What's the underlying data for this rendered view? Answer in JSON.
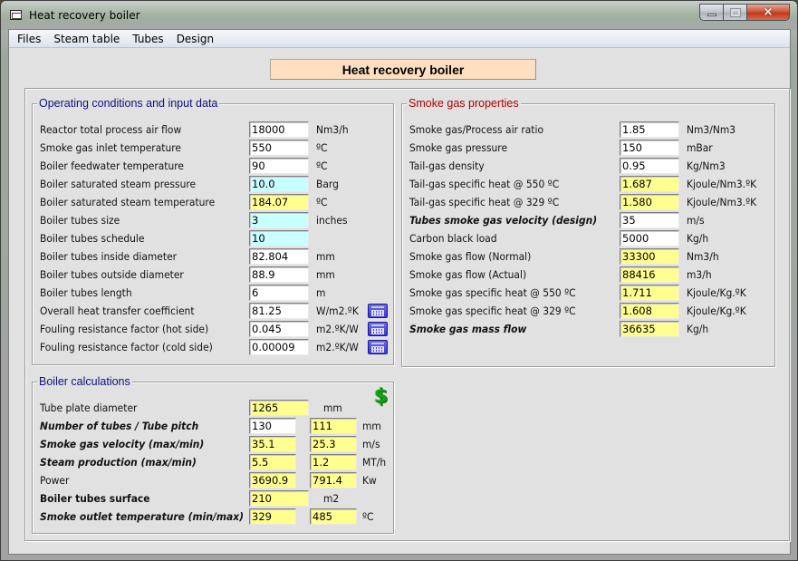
{
  "window": {
    "title": "Heat recovery boiler",
    "controls": {
      "minimize": "minimize",
      "maximize": "maximize",
      "close": "×"
    }
  },
  "menu": [
    "Files",
    "Steam table",
    "Tubes",
    "Design"
  ],
  "banner": "Heat recovery boiler",
  "colors": {
    "input_white": "#ffffff",
    "input_cyan": "#c8ffff",
    "computed_yellow": "#ffff90",
    "title_blue": "#101080",
    "title_red": "#b00000",
    "banner_bg": "#ffdfbf"
  },
  "operating": {
    "title": "Operating conditions and input data",
    "rows": [
      {
        "label": "Reactor total process air flow",
        "value": "18000",
        "unit": "Nm3/h"
      },
      {
        "label": "Smoke gas inlet temperature",
        "value": "550",
        "unit": "ºC"
      },
      {
        "label": "Boiler feedwater temperature",
        "value": "90",
        "unit": "ºC"
      },
      {
        "label": "Boiler saturated steam pressure",
        "value": "10.0",
        "unit": "Barg"
      },
      {
        "label": "Boiler saturated steam temperature",
        "value": "184.07",
        "unit": "ºC"
      },
      {
        "label": "Boiler tubes size",
        "value": "3",
        "unit": "inches"
      },
      {
        "label": "Boiler tubes schedule",
        "value": "10",
        "unit": ""
      },
      {
        "label": "Boiler tubes inside diameter",
        "value": "82.804",
        "unit": "mm"
      },
      {
        "label": "Boiler tubes outside diameter",
        "value": "88.9",
        "unit": "mm"
      },
      {
        "label": "Boiler tubes length",
        "value": "6",
        "unit": "m"
      },
      {
        "label": "Overall heat transfer coefficient",
        "value": "81.25",
        "unit": "W/m2.ºK"
      },
      {
        "label": "Fouling resistance factor (hot side)",
        "value": "0.045",
        "unit": "m2.ºK/W"
      },
      {
        "label": "Fouling resistance factor (cold side)",
        "value": "0.00009",
        "unit": "m2.ºK/W"
      }
    ]
  },
  "smoke": {
    "title": "Smoke gas properties",
    "rows": [
      {
        "label": "Smoke gas/Process air ratio",
        "value": "1.85",
        "unit": "Nm3/Nm3"
      },
      {
        "label": "Smoke gas pressure",
        "value": "150",
        "unit": "mBar"
      },
      {
        "label": "Tail-gas density",
        "value": "0.95",
        "unit": "Kg/Nm3"
      },
      {
        "label": "Tail-gas specific heat @ 550 ºC",
        "value": "1.687",
        "unit": "Kjoule/Nm3.ºK"
      },
      {
        "label": "Tail-gas specific heat @ 329 ºC",
        "value": "1.580",
        "unit": "Kjoule/Nm3.ºK"
      },
      {
        "label": "Tubes smoke gas velocity (design)",
        "value": "35",
        "unit": "m/s"
      },
      {
        "label": "Carbon black load",
        "value": "5000",
        "unit": "Kg/h"
      },
      {
        "label": "Smoke gas flow (Normal)",
        "value": "33300",
        "unit": "Nm3/h"
      },
      {
        "label": "Smoke gas flow (Actual)",
        "value": "88416",
        "unit": "m3/h"
      },
      {
        "label": "Smoke gas specific heat @ 550 ºC",
        "value": "1.711",
        "unit": "Kjoule/Kg.ºK"
      },
      {
        "label": "Smoke gas specific heat @ 329 ºC",
        "value": "1.608",
        "unit": "Kjoule/Kg.ºK"
      },
      {
        "label": "Smoke gas mass flow",
        "value": "36635",
        "unit": "Kg/h"
      }
    ]
  },
  "calc": {
    "title": "Boiler calculations",
    "rows": [
      {
        "label": "Tube plate diameter",
        "value1": "1265",
        "unit": "mm"
      },
      {
        "label": "Number of tubes / Tube pitch",
        "value1": "130",
        "value2": "111",
        "unit": "mm"
      },
      {
        "label": "Smoke gas velocity (max/min)",
        "value1": "35.1",
        "value2": "25.3",
        "unit": "m/s"
      },
      {
        "label": "Steam production (max/min)",
        "value1": "5.5",
        "value2": "1.2",
        "unit": "MT/h"
      },
      {
        "label": "Power",
        "value1": "3690.9",
        "value2": "791.4",
        "unit": "Kw"
      },
      {
        "label": "Boiler tubes surface",
        "value1": "210",
        "unit": "m2"
      },
      {
        "label": "Smoke outlet temperature (min/max)",
        "value1": "329",
        "value2": "485",
        "unit": "ºC"
      }
    ],
    "cost_icon": "$"
  }
}
